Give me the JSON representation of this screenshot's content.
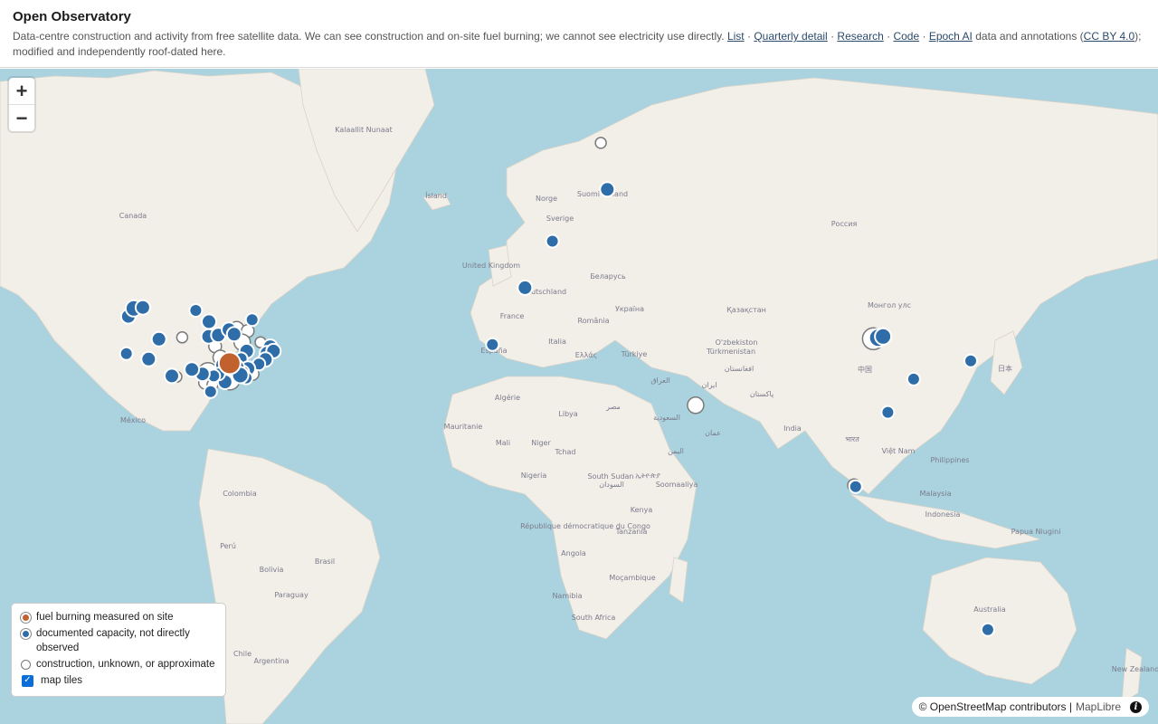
{
  "header": {
    "title": "Open Observatory",
    "desc_prefix": "Data-centre construction and activity from free satellite data. We can see construction and on-site fuel burning; we cannot see electricity use directly.",
    "links": [
      "List",
      "Quarterly detail",
      "Research",
      "Code",
      "Epoch AI",
      "CC BY 4.0"
    ],
    "sep": "·",
    "desc_mid": "data and annotations (",
    "desc_suffix": "); modified and independently roof-dated here."
  },
  "zoom": {
    "in": "+",
    "out": "−"
  },
  "legend": {
    "fuel": "fuel burning measured on site",
    "documented": "documented capacity, not directly observed",
    "construction": "construction, unknown, or approximate",
    "tiles": "map tiles"
  },
  "colors": {
    "fuel": "#c0612e",
    "documented": "#2e6da8",
    "construction": "#ffffff",
    "ocean": "#aad3df",
    "land": "#f2efe9"
  },
  "attribution": {
    "osm": "© OpenStreetMap contributors |",
    "maplibre": "MapLibre",
    "info_icon": "info-icon"
  },
  "places": [
    "Kalaallit Nunaat",
    "Canada",
    "Ísland",
    "Norge",
    "Sverige",
    "Suomi Finland",
    "United Kingdom",
    "Deutschland",
    "France",
    "España",
    "Italia",
    "Беларусь",
    "Україна",
    "România",
    "Ελλάς",
    "Türkiye",
    "Россия",
    "Қазақстан",
    "O'zbekiston",
    "Türkmenistan",
    "Монгол улс",
    "中国",
    "日本",
    "India",
    "भारत",
    "Việt Nam",
    "Philippines",
    "Malaysia",
    "Indonesia",
    "Papua Niugini",
    "Australia",
    "New Zealand",
    "México",
    "Colombia",
    "Perú",
    "Brasil",
    "Bolivia",
    "Paraguay",
    "Chile",
    "Argentina",
    "Mauritanie",
    "Mali",
    "Niger",
    "Tchad",
    "Libya",
    "مصر",
    "Algérie",
    "Nigeria",
    "South Sudan",
    "السودان",
    "ኢትዮጵያ",
    "Soomaaliya",
    "Kenya",
    "Tanzania",
    "République démocratique du Congo",
    "Angola",
    "Namibia",
    "Moçambique",
    "South Africa",
    "ایران",
    "العراق",
    "السعودية",
    "عمان",
    "اليمن",
    "پاکستان",
    "افغانستان"
  ],
  "sites": [
    {
      "lon": -122.1,
      "lat": 37.4,
      "status": "documented",
      "size": 7
    },
    {
      "lon": -121.5,
      "lat": 45.6,
      "status": "documented",
      "size": 8
    },
    {
      "lon": -119.8,
      "lat": 47.2,
      "status": "documented",
      "size": 9
    },
    {
      "lon": -117.0,
      "lat": 47.4,
      "status": "documented",
      "size": 8
    },
    {
      "lon": -112.0,
      "lat": 40.7,
      "status": "documented",
      "size": 8
    },
    {
      "lon": -115.2,
      "lat": 36.1,
      "status": "documented",
      "size": 8
    },
    {
      "lon": -104.8,
      "lat": 41.1,
      "status": "construction",
      "size": 6
    },
    {
      "lon": -96.6,
      "lat": 41.3,
      "status": "documented",
      "size": 8
    },
    {
      "lon": -100.6,
      "lat": 46.8,
      "status": "documented",
      "size": 7
    },
    {
      "lon": -96.5,
      "lat": 44.5,
      "status": "documented",
      "size": 8
    },
    {
      "lon": -93.6,
      "lat": 41.6,
      "status": "documented",
      "size": 8
    },
    {
      "lon": -90.3,
      "lat": 42.8,
      "status": "documented",
      "size": 8
    },
    {
      "lon": -87.9,
      "lat": 43.0,
      "status": "construction",
      "size": 8
    },
    {
      "lon": -88.7,
      "lat": 41.8,
      "status": "documented",
      "size": 8
    },
    {
      "lon": -84.5,
      "lat": 42.5,
      "status": "construction",
      "size": 7
    },
    {
      "lon": -83.1,
      "lat": 44.9,
      "status": "documented",
      "size": 7
    },
    {
      "lon": -86.2,
      "lat": 40.0,
      "status": "construction",
      "size": 9
    },
    {
      "lon": -80.5,
      "lat": 40.0,
      "status": "construction",
      "size": 6
    },
    {
      "lon": -77.5,
      "lat": 39.0,
      "status": "documented",
      "size": 8
    },
    {
      "lon": -78.5,
      "lat": 37.5,
      "status": "documented",
      "size": 8
    },
    {
      "lon": -76.5,
      "lat": 38.0,
      "status": "documented",
      "size": 8
    },
    {
      "lon": -79.0,
      "lat": 36.0,
      "status": "documented",
      "size": 8
    },
    {
      "lon": -84.8,
      "lat": 38.0,
      "status": "documented",
      "size": 8
    },
    {
      "lon": -86.5,
      "lat": 36.2,
      "status": "documented",
      "size": 7
    },
    {
      "lon": -81.0,
      "lat": 34.9,
      "status": "documented",
      "size": 7
    },
    {
      "lon": -84.4,
      "lat": 33.8,
      "status": "documented",
      "size": 8
    },
    {
      "lon": -86.0,
      "lat": 33.0,
      "status": "documented",
      "size": 7
    },
    {
      "lon": -83.0,
      "lat": 32.5,
      "status": "construction",
      "size": 7
    },
    {
      "lon": -85.0,
      "lat": 31.5,
      "status": "documented",
      "size": 7
    },
    {
      "lon": -90.1,
      "lat": 35.1,
      "status": "fuel",
      "size": 12
    },
    {
      "lon": -92.3,
      "lat": 34.7,
      "status": "documented",
      "size": 8
    },
    {
      "lon": -88.0,
      "lat": 34.0,
      "status": "documented",
      "size": 9
    },
    {
      "lon": -86.8,
      "lat": 32.2,
      "status": "documented",
      "size": 9
    },
    {
      "lon": -90.0,
      "lat": 31.0,
      "status": "construction",
      "size": 11
    },
    {
      "lon": -91.5,
      "lat": 30.5,
      "status": "documented",
      "size": 8
    },
    {
      "lon": -93.5,
      "lat": 32.5,
      "status": "documented",
      "size": 7
    },
    {
      "lon": -95.0,
      "lat": 32.0,
      "status": "documented",
      "size": 7
    },
    {
      "lon": -96.8,
      "lat": 32.8,
      "status": "construction",
      "size": 11
    },
    {
      "lon": -97.7,
      "lat": 30.3,
      "status": "construction",
      "size": 7
    },
    {
      "lon": -95.4,
      "lat": 29.8,
      "status": "construction",
      "size": 6
    },
    {
      "lon": -96.0,
      "lat": 28.0,
      "status": "documented",
      "size": 7
    },
    {
      "lon": -98.5,
      "lat": 32.5,
      "status": "documented",
      "size": 8
    },
    {
      "lon": -101.8,
      "lat": 33.6,
      "status": "documented",
      "size": 8
    },
    {
      "lon": -106.6,
      "lat": 31.8,
      "status": "construction",
      "size": 6
    },
    {
      "lon": -108.0,
      "lat": 32.0,
      "status": "documented",
      "size": 8
    },
    {
      "lon": -94.6,
      "lat": 39.1,
      "status": "construction",
      "size": 7
    },
    {
      "lon": -93.0,
      "lat": 36.5,
      "status": "construction",
      "size": 8
    },
    {
      "lon": 25.0,
      "lat": 71.0,
      "status": "construction",
      "size": 6
    },
    {
      "lon": 27.0,
      "lat": 66.0,
      "status": "documented",
      "size": 8
    },
    {
      "lon": 10.0,
      "lat": 59.0,
      "status": "documented",
      "size": 7
    },
    {
      "lon": 1.5,
      "lat": 51.2,
      "status": "documented",
      "size": 8
    },
    {
      "lon": -8.6,
      "lat": 39.5,
      "status": "documented",
      "size": 7
    },
    {
      "lon": 54.4,
      "lat": 24.4,
      "status": "construction",
      "size": 9
    },
    {
      "lon": 109.5,
      "lat": 40.8,
      "status": "construction",
      "size": 12
    },
    {
      "lon": 111.0,
      "lat": 41.0,
      "status": "documented",
      "size": 10
    },
    {
      "lon": 112.5,
      "lat": 41.3,
      "status": "documented",
      "size": 9
    },
    {
      "lon": 122.0,
      "lat": 31.2,
      "status": "documented",
      "size": 7
    },
    {
      "lon": 114.0,
      "lat": 22.5,
      "status": "documented",
      "size": 7
    },
    {
      "lon": 139.7,
      "lat": 35.7,
      "status": "documented",
      "size": 7
    },
    {
      "lon": 103.5,
      "lat": 1.6,
      "status": "construction",
      "size": 7
    },
    {
      "lon": 104.0,
      "lat": 1.2,
      "status": "documented",
      "size": 7
    },
    {
      "lon": 145.0,
      "lat": -37.8,
      "status": "documented",
      "size": 7
    }
  ]
}
